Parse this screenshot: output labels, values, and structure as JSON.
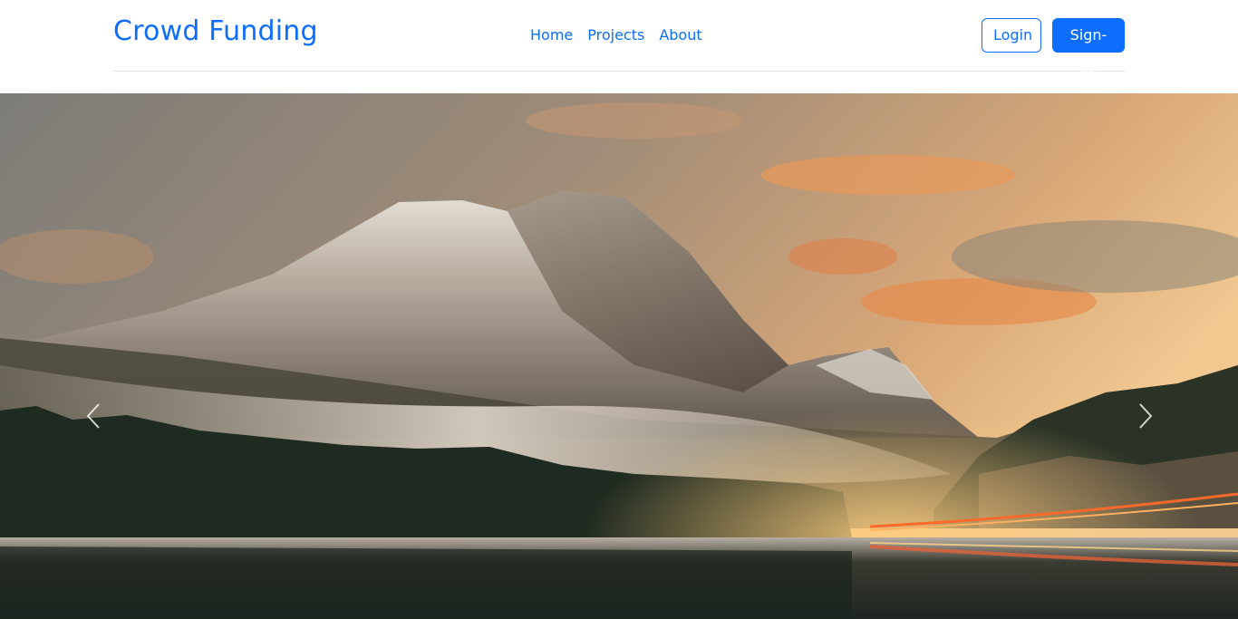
{
  "navbar": {
    "brand": "Crowd Funding",
    "links": [
      {
        "label": "Home"
      },
      {
        "label": "Projects"
      },
      {
        "label": "About"
      }
    ],
    "login_label": "Login",
    "signup_label": "Sign-up"
  },
  "carousel": {
    "prev_icon": "chevron-left-icon",
    "next_icon": "chevron-right-icon"
  },
  "colors": {
    "primary": "#0d6efd",
    "divider": "#dee2e6"
  }
}
